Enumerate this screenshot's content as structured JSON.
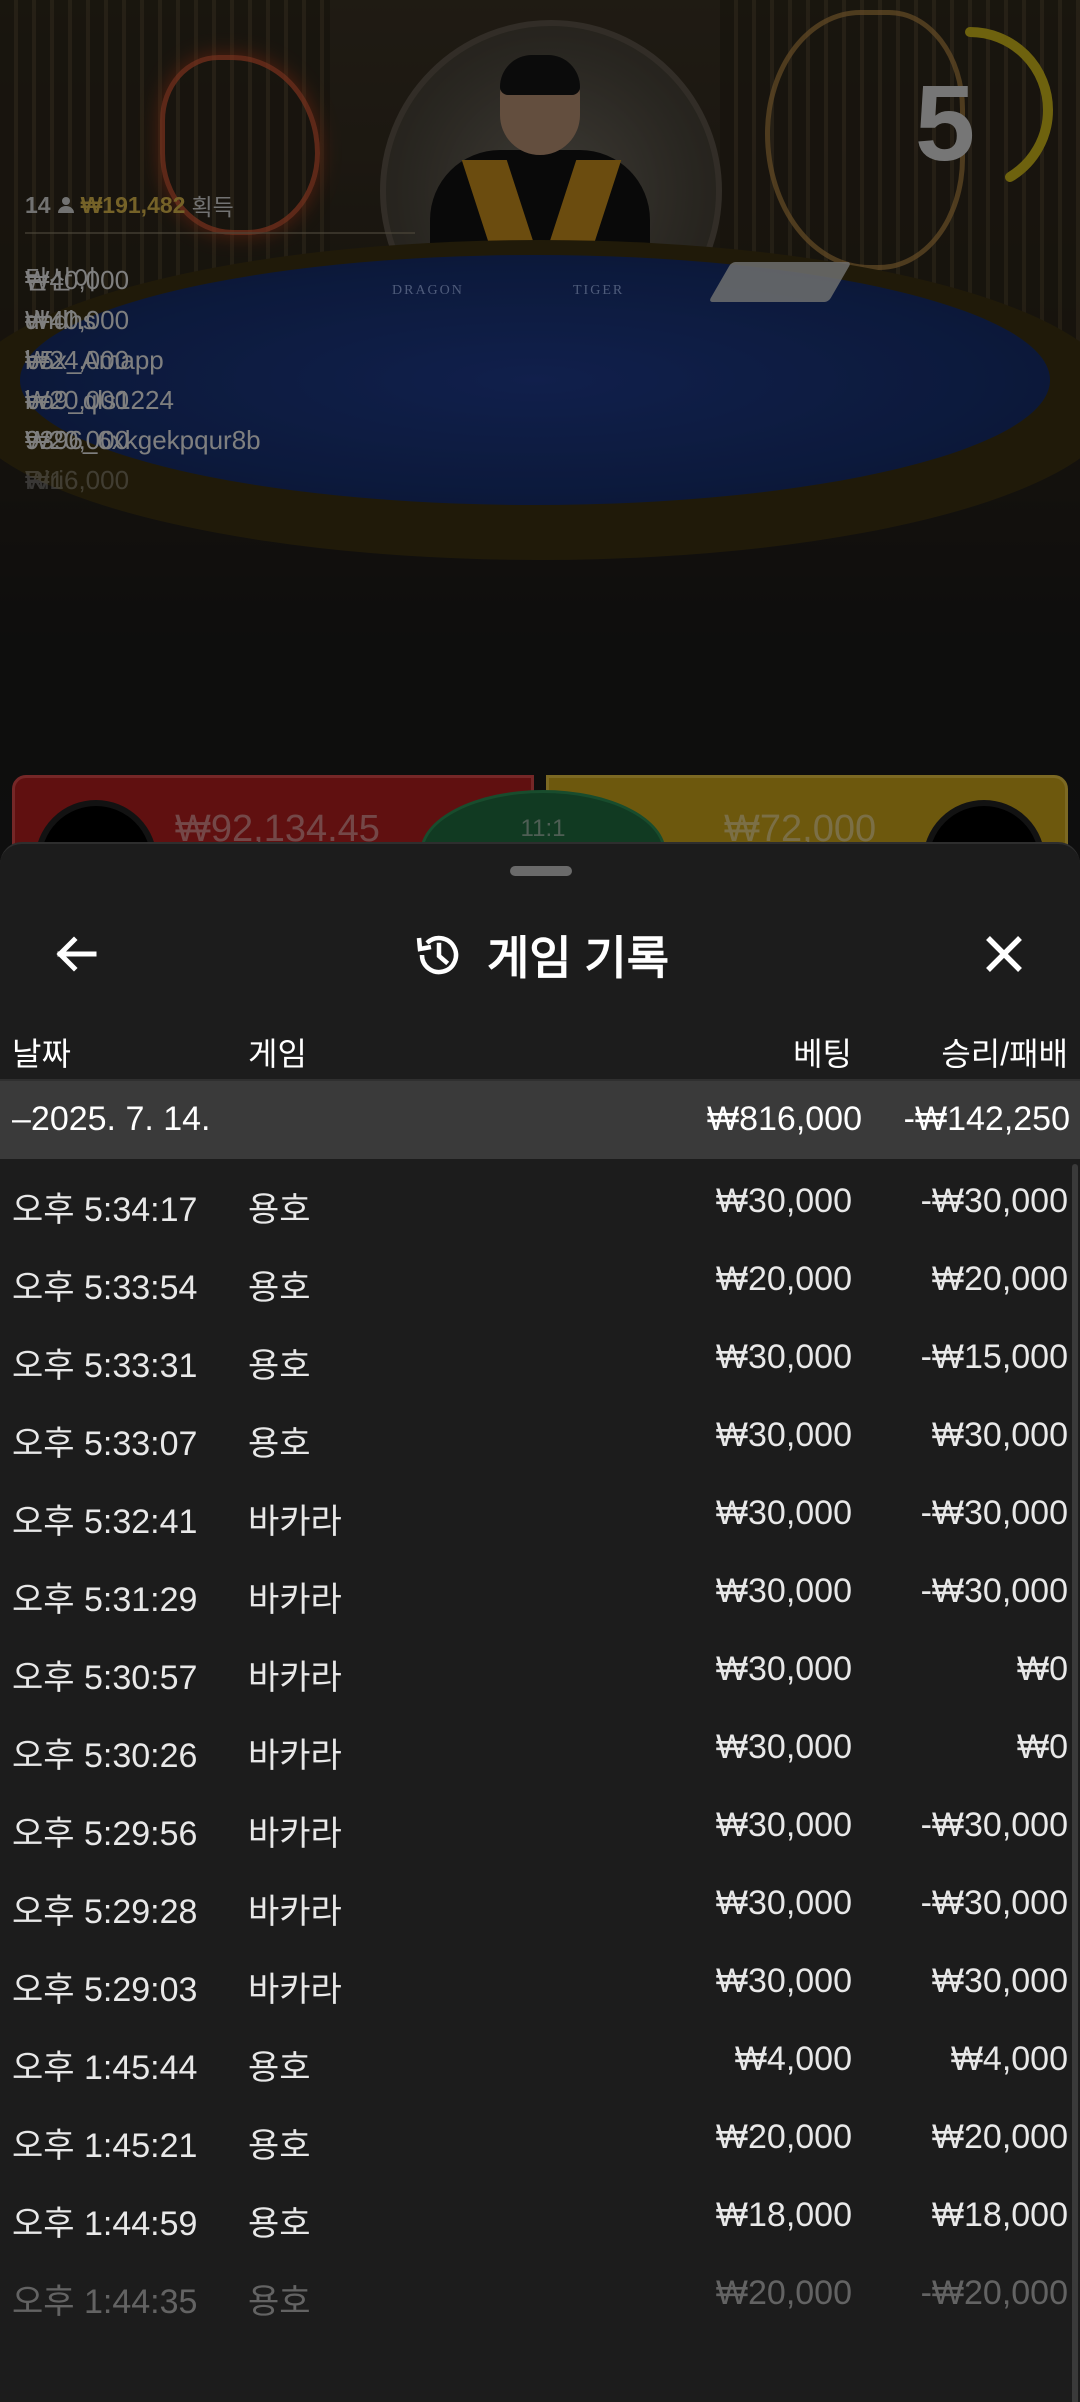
{
  "stream": {
    "timer": "5",
    "felt_dragon": "DRAGON",
    "felt_tiger": "TIGER"
  },
  "winners": {
    "count": "14",
    "total": "₩191,482",
    "label": "획득",
    "list": [
      {
        "amount": "₩40,000",
        "name": "탄산이"
      },
      {
        "amount": "₩40,000",
        "name": "dhdhs"
      },
      {
        "amount": "₩24,000",
        "name": "b5x_Amapp"
      },
      {
        "amount": "₩20,000",
        "name": "bo9_qls1224"
      },
      {
        "amount": "₩20,000",
        "name": "9396_6xkgekpqur8b"
      },
      {
        "amount": "₩16,000",
        "name": "Riri"
      }
    ]
  },
  "bets": {
    "dragon_amount": "₩92,134.45",
    "tie_label": "11:1",
    "tiger_amount": "₩72,000"
  },
  "sheet": {
    "title": "게임 기록",
    "columns": {
      "date": "날짜",
      "game": "게임",
      "bet": "베팅",
      "result": "승리/패배"
    },
    "summary": {
      "date": "–2025. 7. 14.",
      "bet": "₩816,000",
      "result": "-₩142,250"
    },
    "rows": [
      {
        "time": "오후 5:34:17",
        "game": "용호",
        "bet": "₩30,000",
        "result": "-₩30,000"
      },
      {
        "time": "오후 5:33:54",
        "game": "용호",
        "bet": "₩20,000",
        "result": "₩20,000"
      },
      {
        "time": "오후 5:33:31",
        "game": "용호",
        "bet": "₩30,000",
        "result": "-₩15,000"
      },
      {
        "time": "오후 5:33:07",
        "game": "용호",
        "bet": "₩30,000",
        "result": "₩30,000"
      },
      {
        "time": "오후 5:32:41",
        "game": "바카라",
        "bet": "₩30,000",
        "result": "-₩30,000"
      },
      {
        "time": "오후 5:31:29",
        "game": "바카라",
        "bet": "₩30,000",
        "result": "-₩30,000"
      },
      {
        "time": "오후 5:30:57",
        "game": "바카라",
        "bet": "₩30,000",
        "result": "₩0"
      },
      {
        "time": "오후 5:30:26",
        "game": "바카라",
        "bet": "₩30,000",
        "result": "₩0"
      },
      {
        "time": "오후 5:29:56",
        "game": "바카라",
        "bet": "₩30,000",
        "result": "-₩30,000"
      },
      {
        "time": "오후 5:29:28",
        "game": "바카라",
        "bet": "₩30,000",
        "result": "-₩30,000"
      },
      {
        "time": "오후 5:29:03",
        "game": "바카라",
        "bet": "₩30,000",
        "result": "₩30,000"
      },
      {
        "time": "오후 1:45:44",
        "game": "용호",
        "bet": "₩4,000",
        "result": "₩4,000"
      },
      {
        "time": "오후 1:45:21",
        "game": "용호",
        "bet": "₩20,000",
        "result": "₩20,000"
      },
      {
        "time": "오후 1:44:59",
        "game": "용호",
        "bet": "₩18,000",
        "result": "₩18,000"
      },
      {
        "time": "오후 1:44:35",
        "game": "용호",
        "bet": "₩20,000",
        "result": "-₩20,000"
      }
    ]
  },
  "icons": {
    "back": "arrow-left-icon",
    "close": "close-icon",
    "history": "history-icon",
    "user": "user-icon"
  }
}
